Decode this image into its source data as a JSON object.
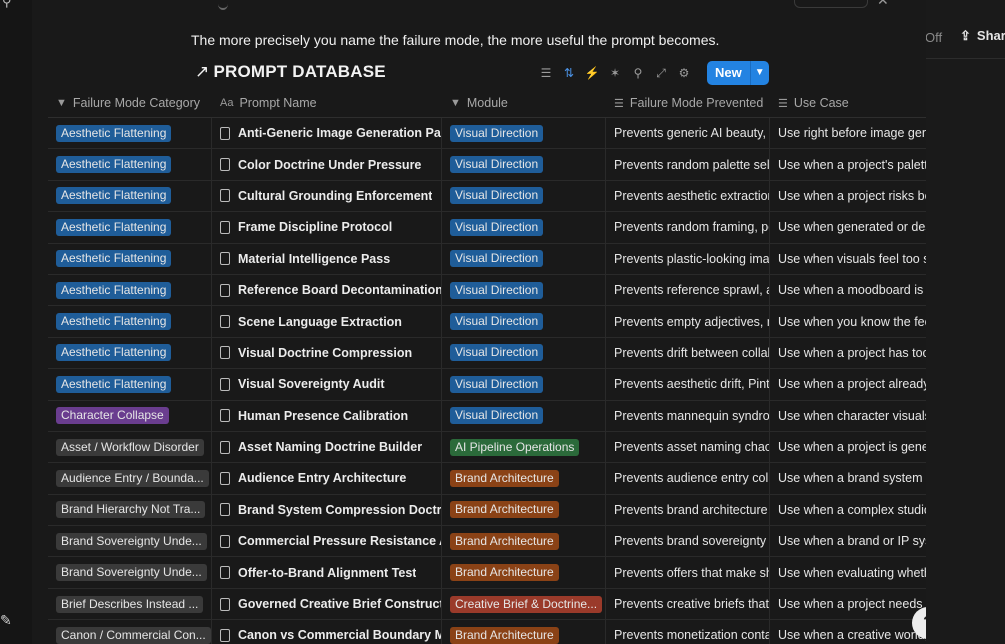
{
  "tagline": "The more precisely you name the failure mode, the more useful the prompt becomes.",
  "database": {
    "title": "PROMPT DATABASE",
    "title_icon": "arrow-up-right-icon"
  },
  "toolbar": {
    "icons": [
      "filter-icon",
      "sort-icon",
      "automation-icon",
      "ai-icon",
      "search-icon",
      "expand-icon",
      "settings-icon"
    ],
    "new_label": "New"
  },
  "right_panel": {
    "off_label": "Off",
    "share_label": "Share"
  },
  "columns": [
    {
      "label": "Failure Mode Category",
      "icon": "select-icon"
    },
    {
      "label": "Prompt Name",
      "icon": "text-icon"
    },
    {
      "label": "Module",
      "icon": "select-icon"
    },
    {
      "label": "Failure Mode Prevented",
      "icon": "lines-icon"
    },
    {
      "label": "Use Case",
      "icon": "lines-icon"
    }
  ],
  "tag_colors": {
    "blue": "#1f5d99",
    "purple": "#6a3d8f",
    "gray": "#3a3a3a",
    "green": "#2b6a3a",
    "orange": "#8a4216",
    "red": "#9a3a2a"
  },
  "rows": [
    {
      "category": "Aesthetic Flattening",
      "cat_color": "blue",
      "name": "Anti-Generic Image Generation Pack",
      "module": "Visual Direction",
      "mod_color": "blue",
      "prevented": "Prevents generic AI beauty, ov",
      "use_case": "Use right before image gene"
    },
    {
      "category": "Aesthetic Flattening",
      "cat_color": "blue",
      "name": "Color Doctrine Under Pressure",
      "module": "Visual Direction",
      "mod_color": "blue",
      "prevented": "Prevents random palette selec",
      "use_case": "Use when a project's palette"
    },
    {
      "category": "Aesthetic Flattening",
      "cat_color": "blue",
      "name": "Cultural Grounding Enforcement",
      "module": "Visual Direction",
      "mod_color": "blue",
      "prevented": "Prevents aesthetic extraction,",
      "use_case": "Use when a project risks be"
    },
    {
      "category": "Aesthetic Flattening",
      "cat_color": "blue",
      "name": "Frame Discipline Protocol",
      "module": "Visual Direction",
      "mod_color": "blue",
      "prevented": "Prevents random framing, pos",
      "use_case": "Use when generated or des"
    },
    {
      "category": "Aesthetic Flattening",
      "cat_color": "blue",
      "name": "Material Intelligence Pass",
      "module": "Visual Direction",
      "mod_color": "blue",
      "prevented": "Prevents plastic-looking image",
      "use_case": "Use when visuals feel too sl"
    },
    {
      "category": "Aesthetic Flattening",
      "cat_color": "blue",
      "name": "Reference Board Decontamination",
      "module": "Visual Direction",
      "mod_color": "blue",
      "prevented": "Prevents reference sprawl, aes",
      "use_case": "Use when a moodboard is c"
    },
    {
      "category": "Aesthetic Flattening",
      "cat_color": "blue",
      "name": "Scene Language Extraction",
      "module": "Visual Direction",
      "mod_color": "blue",
      "prevented": "Prevents empty adjectives, mo",
      "use_case": "Use when you know the fee"
    },
    {
      "category": "Aesthetic Flattening",
      "cat_color": "blue",
      "name": "Visual Doctrine Compression",
      "module": "Visual Direction",
      "mod_color": "blue",
      "prevented": "Prevents drift between collabo",
      "use_case": "Use when a project has too"
    },
    {
      "category": "Aesthetic Flattening",
      "cat_color": "blue",
      "name": "Visual Sovereignty Audit",
      "module": "Visual Direction",
      "mod_color": "blue",
      "prevented": "Prevents aesthetic drift, Pinter",
      "use_case": "Use when a project already"
    },
    {
      "category": "Character Collapse",
      "cat_color": "purple",
      "name": "Human Presence Calibration",
      "module": "Visual Direction",
      "mod_color": "blue",
      "prevented": "Prevents mannequin syndrome",
      "use_case": "Use when character visuals"
    },
    {
      "category": "Asset / Workflow Disorder",
      "cat_color": "gray",
      "name": "Asset Naming Doctrine Builder",
      "module": "AI Pipeline Operations",
      "mod_color": "green",
      "prevented": "Prevents asset naming chaos",
      "use_case": "Use when a project is gener"
    },
    {
      "category": "Audience Entry / Bounda...",
      "cat_color": "gray",
      "name": "Audience Entry Architecture",
      "module": "Brand Architecture",
      "mod_color": "orange",
      "prevented": "Prevents audience entry collap",
      "use_case": "Use when a brand system c"
    },
    {
      "category": "Brand Hierarchy Not Tra...",
      "cat_color": "gray",
      "name": "Brand System Compression Doctrine",
      "module": "Brand Architecture",
      "mod_color": "orange",
      "prevented": "Prevents brand architecture fr",
      "use_case": "Use when a complex studio"
    },
    {
      "category": "Brand Sovereignty Unde...",
      "cat_color": "gray",
      "name": "Commercial Pressure Resistance Audit",
      "module": "Brand Architecture",
      "mod_color": "orange",
      "prevented": "Prevents brand sovereignty co",
      "use_case": "Use when a brand or IP syst"
    },
    {
      "category": "Brand Sovereignty Unde...",
      "cat_color": "gray",
      "name": "Offer-to-Brand Alignment Test",
      "module": "Brand Architecture",
      "mod_color": "orange",
      "prevented": "Prevents offers that make sho",
      "use_case": "Use when evaluating wheth"
    },
    {
      "category": "Brief Describes Instead ...",
      "cat_color": "gray",
      "name": "Governed Creative Brief Constructor",
      "module": "Creative Brief & Doctrine...",
      "mod_color": "red",
      "prevented": "Prevents creative briefs that d",
      "use_case": "Use when a project needs a"
    },
    {
      "category": "Canon / Commercial Con...",
      "cat_color": "gray",
      "name": "Canon vs Commercial Boundary Map",
      "module": "Brand Architecture",
      "mod_color": "orange",
      "prevented": "Prevents monetization contam",
      "use_case": "Use when a creative world,"
    }
  ]
}
